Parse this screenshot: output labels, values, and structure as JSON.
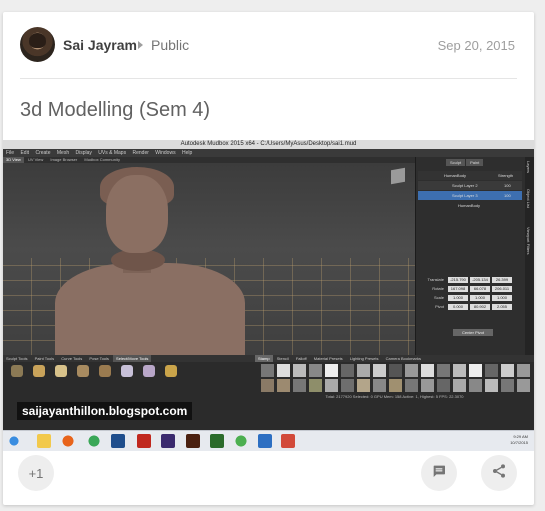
{
  "post": {
    "author": "Sai Jayram",
    "visibility": "Public",
    "date": "Sep 20, 2015",
    "title": "3d Modelling (Sem 4)",
    "plusone_label": "+1"
  },
  "screenshot": {
    "window_title": "Autodesk Mudbox 2015 x64 - C:/Users/MyAsus/Desktop/sai1.mud",
    "menu": [
      "File",
      "Edit",
      "Create",
      "Mesh",
      "Display",
      "UVs & Maps",
      "Render",
      "Windows",
      "Help"
    ],
    "view_tabs": [
      "3D View",
      "UV View",
      "Image Browser",
      "Mudbox Community"
    ],
    "panel_tabs": [
      "Sculpt",
      "Paint"
    ],
    "layers_header": [
      "HumanBody",
      "Strength"
    ],
    "layers": [
      {
        "name": "Sculpt Layer 2",
        "strength": "100"
      },
      {
        "name": "Sculpt Layer 3",
        "strength": "100"
      },
      {
        "name": "HumanBody",
        "strength": ""
      }
    ],
    "props": [
      {
        "label": "Translate",
        "values": [
          "-215.790",
          "-205.134",
          "26.399"
        ]
      },
      {
        "label": "Rotate",
        "values": [
          "167.098",
          "66.078",
          "206.011"
        ]
      },
      {
        "label": "Scale",
        "values": [
          "1.000",
          "1.000",
          "1.000"
        ]
      },
      {
        "label": "Pivot",
        "values": [
          "0.000",
          "80.902",
          "2.055"
        ]
      }
    ],
    "center_pivot": "Center Pivot",
    "side_tabs": [
      "Layers",
      "Object List",
      "Viewport Filters"
    ],
    "tool_tabs": [
      "Sculpt Tools",
      "Paint Tools",
      "Curve Tools",
      "Pose Tools",
      "Select/Move Tools"
    ],
    "stamp_tabs": [
      "Stamp",
      "Stencil",
      "Falloff",
      "Material Presets",
      "Lighting Presets",
      "Camera Bookmarks"
    ],
    "status": "Total: 2177920  Selected: 0 GPU Mem: 158  Active: 1, Highest: 5  FPS: 22.3070",
    "watermark": "saijayanthillon.blogspot.com",
    "clock_time": "9:29 AM",
    "clock_date": "10/7/2015"
  },
  "colors": {
    "accent": "#3d6fb0",
    "card_bg": "#ffffff",
    "page_bg": "#eeeeee"
  },
  "icons": {
    "visibility": "chevron-right-icon",
    "comment": "comment-icon",
    "share": "share-icon"
  }
}
